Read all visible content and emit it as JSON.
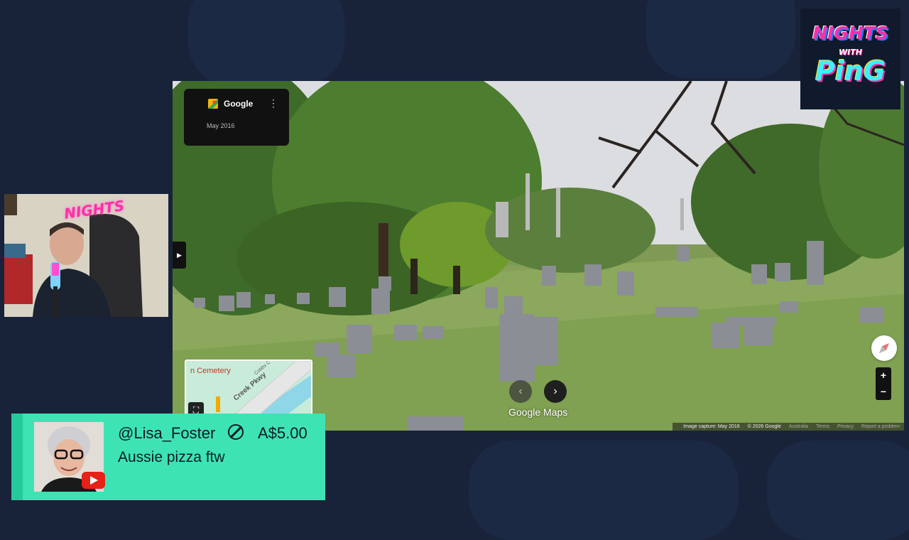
{
  "street_view": {
    "brand": "Google",
    "capture_date": "May 2016",
    "more_icon": "more-vert-icon",
    "logo_text": "Google",
    "logo_suffix": "Maps",
    "minimap": {
      "place_label": "n Cemetery",
      "road_label_1": "Creek Pkwy",
      "road_label_2": "Cobbs C"
    },
    "zoom_in": "+",
    "zoom_out": "−",
    "footer": {
      "capture": "Image capture: May 2016",
      "copyright": "© 2026 Google",
      "region": "Australia",
      "terms": "Terms",
      "privacy": "Privacy",
      "report": "Report a problem"
    }
  },
  "webcam": {
    "sign_text": "NIGHTS"
  },
  "channel_logo": {
    "line1": "NIGHTS",
    "line2": "WITH",
    "line3": "PinG"
  },
  "superchat": {
    "username": "@Lisa_Foster",
    "amount": "A$5.00",
    "message": "Aussie pizza ftw",
    "platform_icon": "youtube-icon"
  },
  "colors": {
    "background": "#18233a",
    "superchat": "#3ee3b4",
    "superchat_stripe": "#26c99a",
    "logo_pink": "#ff2fa6",
    "logo_cyan": "#3cf0ff"
  }
}
